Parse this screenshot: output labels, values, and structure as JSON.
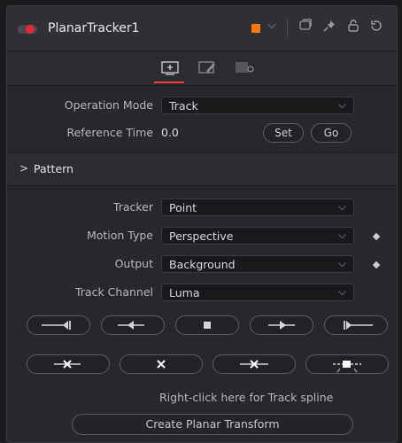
{
  "header": {
    "title": "PlanarTracker1",
    "color_chip": "#ff7a00",
    "toggle_color": "#e8283a",
    "icons": [
      "chevron-down-icon",
      "window-icon",
      "pin-icon",
      "lock-icon",
      "reset-icon"
    ]
  },
  "tabs": [
    "controls-tab-icon",
    "paint-tab-icon",
    "settings-tab-icon"
  ],
  "operation_mode": {
    "label": "Operation Mode",
    "value": "Track"
  },
  "reference_time": {
    "label": "Reference Time",
    "value": "0.0",
    "set_label": "Set",
    "go_label": "Go"
  },
  "pattern_section": {
    "title": "Pattern"
  },
  "tracker": {
    "label": "Tracker",
    "value": "Point"
  },
  "motion_type": {
    "label": "Motion Type",
    "value": "Perspective"
  },
  "output": {
    "label": "Output",
    "value": "Background"
  },
  "track_channel": {
    "label": "Track Channel",
    "value": "Luma"
  },
  "track_buttons": [
    "track-to-start-icon",
    "track-backward-icon",
    "stop-icon",
    "track-forward-icon",
    "track-to-end-icon"
  ],
  "edit_buttons": [
    "delete-previous-icon",
    "delete-icon",
    "delete-next-icon",
    "set-keyframe-icon"
  ],
  "hint": "Right-click here for Track spline",
  "create_button": "Create Planar Transform"
}
